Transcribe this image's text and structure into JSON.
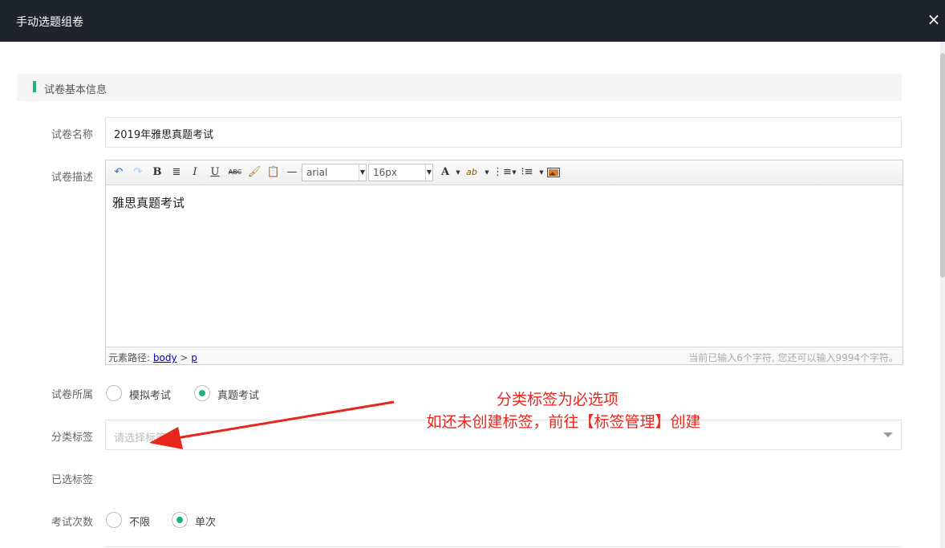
{
  "dialog": {
    "title": "手动选题组卷",
    "close_icon": "×"
  },
  "section": {
    "title": "试卷基本信息"
  },
  "paper_name": {
    "label": "试卷名称",
    "value": "2019年雅思真题考试"
  },
  "description": {
    "label": "试卷描述",
    "toolbar": {
      "font": "arial",
      "size": "16px",
      "bold": "B",
      "italic": "I",
      "underline": "U",
      "strike": "ABC",
      "font_color": "A",
      "highlight": "ab"
    },
    "content": "雅思真题考试",
    "status": {
      "path_label": "元素路径:",
      "path_body": "body",
      "path_sep": ">",
      "path_p": "p",
      "count": "当前已输入6个字符, 您还可以输入9994个字符。"
    }
  },
  "belongs": {
    "label": "试卷所属",
    "options": [
      {
        "label": "模拟考试",
        "checked": false
      },
      {
        "label": "真题考试",
        "checked": true
      }
    ]
  },
  "category": {
    "label": "分类标签",
    "placeholder": "请选择标签"
  },
  "selected_tags": {
    "label": "已选标签"
  },
  "attempts": {
    "label": "考试次数",
    "options": [
      {
        "label": "不限",
        "checked": false
      },
      {
        "label": "单次",
        "checked": true
      }
    ]
  },
  "annotation": {
    "line1": "分类标签为必选项",
    "line2": "如还未创建标签，前往【标签管理】创建",
    "color": "#e8261c"
  },
  "accent_color": "#21b27b"
}
